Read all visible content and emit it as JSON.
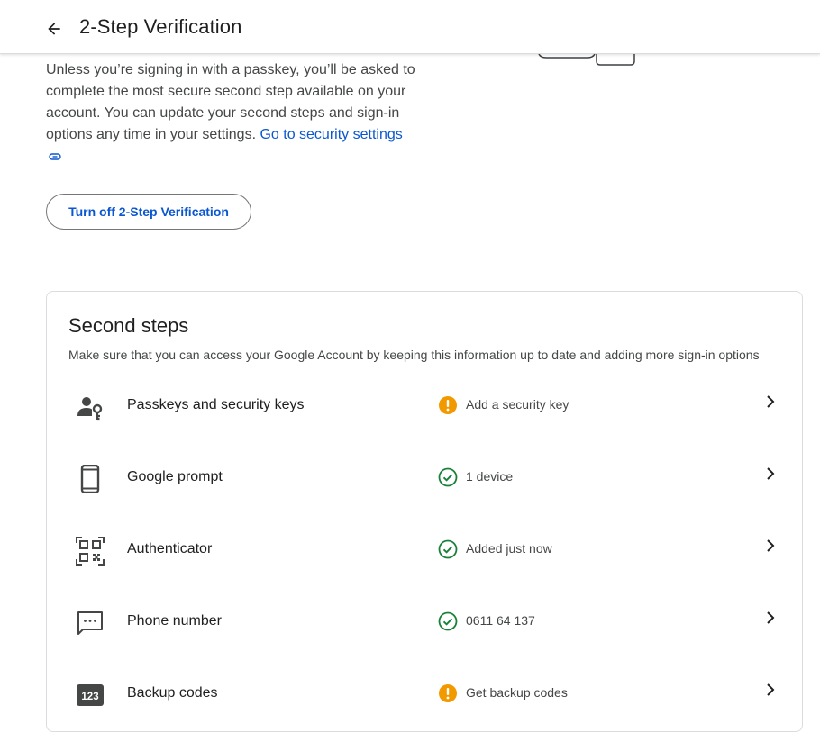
{
  "header": {
    "title": "2-Step Verification",
    "back_icon": "arrow-back-icon"
  },
  "intro": {
    "text": "Unless you’re signing in with a passkey, you’ll be asked to complete the most secure second step available on your account. You can update your second steps and sign-in options any time in your settings. ",
    "link_text": "Go to security settings",
    "link_icon": "link-icon"
  },
  "turn_off_button": {
    "label": "Turn off 2-Step Verification"
  },
  "second_steps": {
    "title": "Second steps",
    "subtitle": "Make sure that you can access your Google Account by keeping this information up to date and adding more sign-in options",
    "items": [
      {
        "label": "Passkeys and security keys",
        "icon": "passkey-icon",
        "status": "Add a security key",
        "status_type": "warning"
      },
      {
        "label": "Google prompt",
        "icon": "phone-icon",
        "status": "1 device",
        "status_type": "ok"
      },
      {
        "label": "Authenticator",
        "icon": "qr-code-icon",
        "status": "Added just now",
        "status_type": "ok"
      },
      {
        "label": "Phone number",
        "icon": "sms-icon",
        "status": "0611 64 137",
        "status_type": "ok"
      },
      {
        "label": "Backup codes",
        "icon": "backup-codes-icon",
        "icon_text": "123",
        "status": "Get backup codes",
        "status_type": "warning"
      }
    ]
  },
  "colors": {
    "link": "#0b57d0",
    "ok": "#188038",
    "warning": "#f29900",
    "icon": "#444746"
  }
}
